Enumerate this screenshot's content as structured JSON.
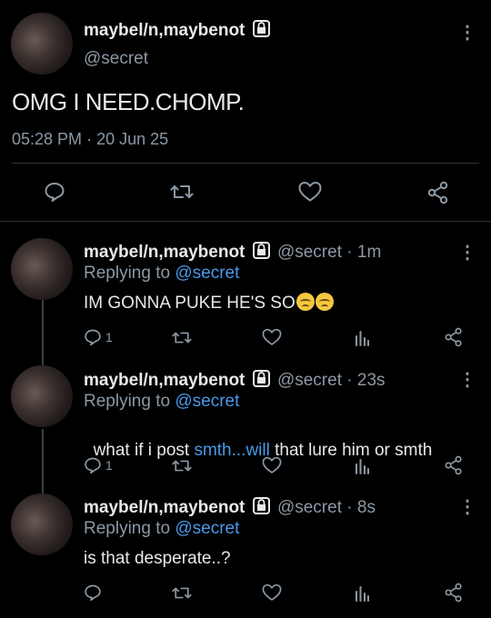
{
  "main": {
    "display_name": "maybel/n,maybenot",
    "handle": "@secret",
    "text": "OMG I NEED.CHOMP.",
    "time": "05:28 PM",
    "date_sep": "·",
    "date": "20 Jun 25"
  },
  "replies": [
    {
      "display_name": "maybel/n,maybenot",
      "handle": "@secret",
      "time": "· 1m",
      "replying_to": "Replying to",
      "replying_handle": "@secret",
      "text": "IM GONNA PUKE HE'S SO",
      "emoji": [
        "🥺",
        "🥺"
      ],
      "reply_count": "1"
    },
    {
      "display_name": "maybel/n,maybenot",
      "handle": "@secret",
      "time": "· 23s",
      "replying_to": "Replying to",
      "replying_handle": "@secret",
      "text_before": "what if i post ",
      "text_link": "smth...will",
      "text_after": " that lure him or smth",
      "reply_count": "1"
    },
    {
      "display_name": "maybel/n,maybenot",
      "handle": "@secret",
      "time": "· 8s",
      "replying_to": "Replying to",
      "replying_handle": "@secret",
      "text": "is that desperate..?"
    }
  ],
  "icons": {
    "lock": "lock-icon",
    "more": "more-vertical-icon",
    "reply": "reply-icon",
    "retweet": "retweet-icon",
    "like": "heart-icon",
    "analytics": "analytics-icon",
    "share": "share-icon"
  },
  "colors": {
    "background": "#000000",
    "text": "#e7e9ea",
    "muted": "#8b98a5",
    "link": "#4a99e9"
  }
}
